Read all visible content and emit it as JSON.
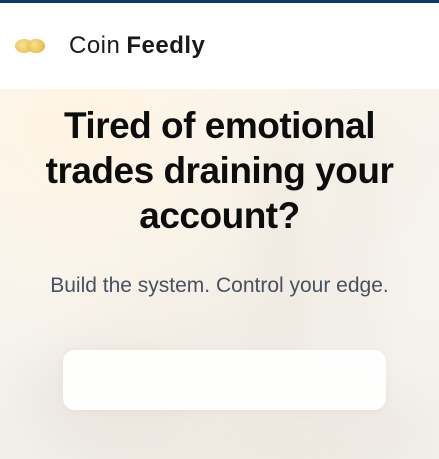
{
  "brand": {
    "name_part1": "Coin",
    "name_part2": "Feedly",
    "logo_icon": "coin-logo-icon",
    "accent_color": "#0d3a66",
    "logo_color": "#e6c24f"
  },
  "hero": {
    "headline": "Tired of emotional trades draining your account?",
    "subheadline": "Build the system. Control your edge.",
    "cta_label": ""
  }
}
